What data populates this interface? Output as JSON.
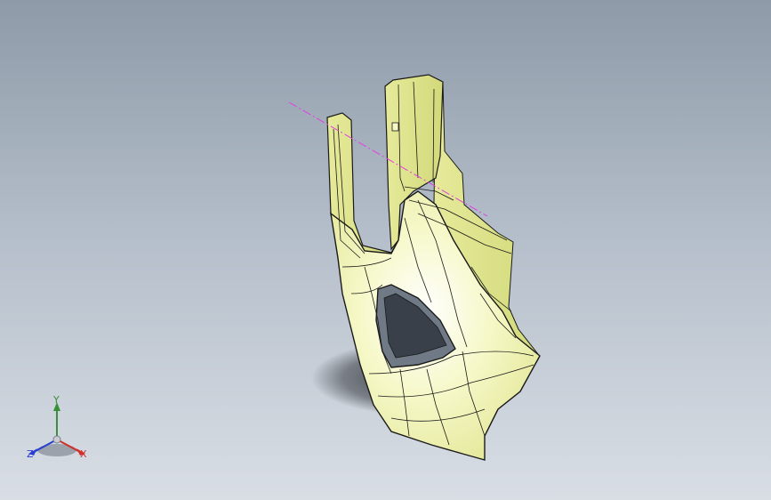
{
  "viewport": {
    "background_top": "#8e9aa8",
    "background_bottom": "#d9dee5"
  },
  "model": {
    "name": "part-model",
    "surface_color": "#f2f5b8",
    "edge_color": "#1a1a1a",
    "centerline_color": "#e040e0"
  },
  "triad": {
    "y_label": "Y",
    "z_label": "Z",
    "x_label": "X",
    "colors": {
      "x": "#d0302a",
      "y": "#3a8f3a",
      "z": "#2a3fd0"
    }
  }
}
